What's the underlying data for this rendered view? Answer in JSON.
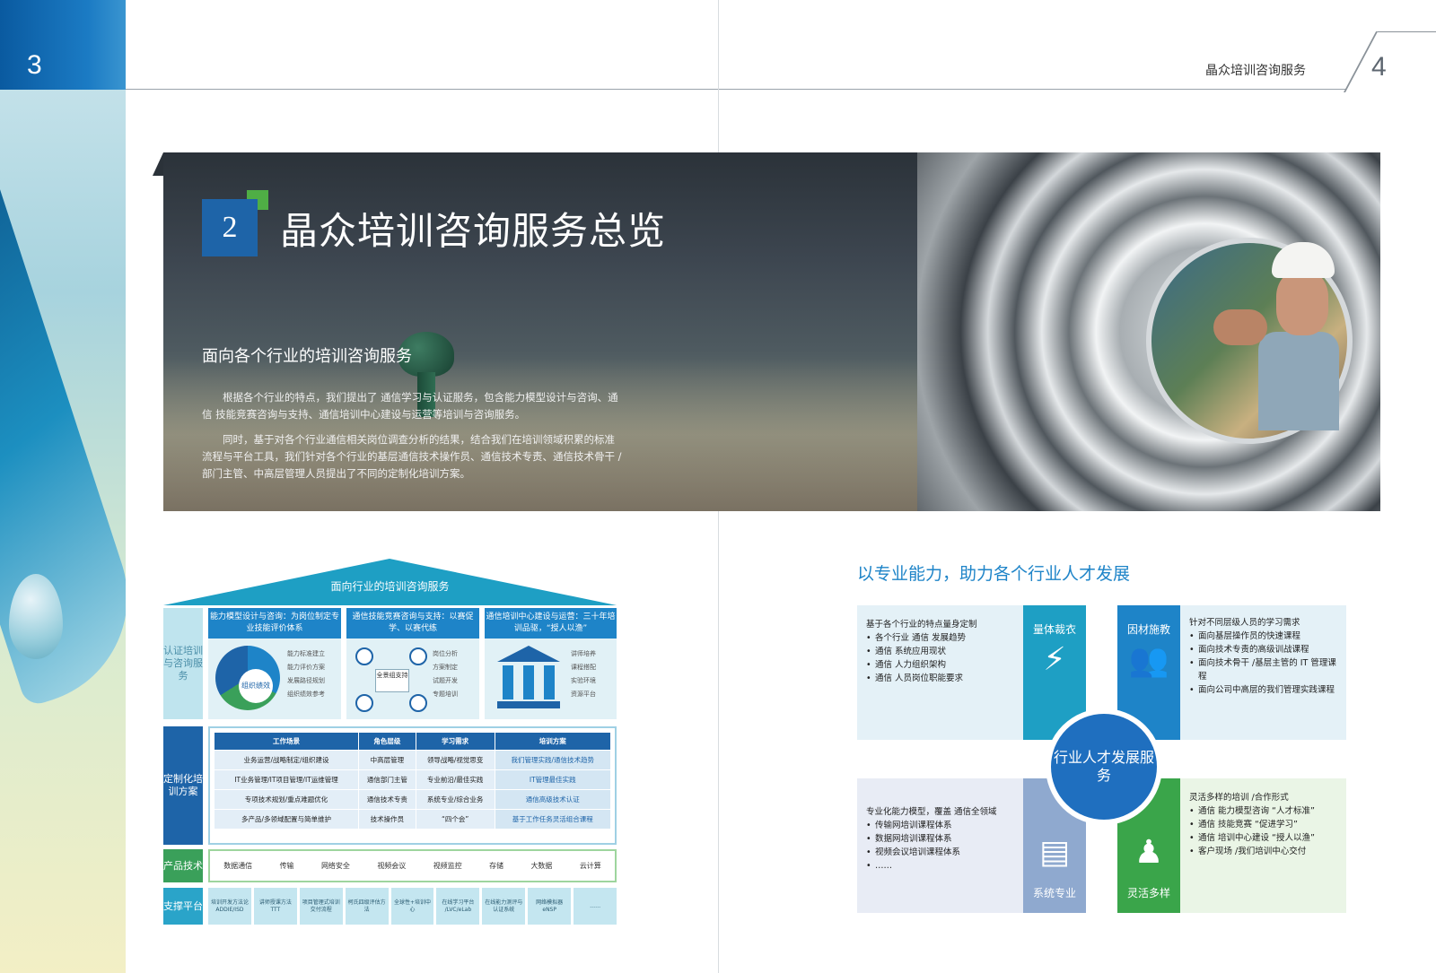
{
  "page": {
    "left_number": "3",
    "right_number": "4",
    "header_title": "晶众培训咨询服务"
  },
  "hero": {
    "section_number": "2",
    "section_title": "晶众培训咨询服务总览",
    "subtitle": "面向各个行业的培训咨询服务",
    "paragraph_1": "根据各个行业的特点，我们提出了 通信学习与认证服务，包含能力模型设计与咨询、通信 技能竞赛咨询与支持、通信培训中心建设与运营等培训与咨询服务。",
    "paragraph_2": "同时，基于对各个行业通信相关岗位调查分析的结果，结合我们在培训领域积累的标准流程与平台工具，我们针对各个行业的基层通信技术操作员、通信技术专责、通信技术骨干 /部门主管、中高层管理人员提出了不同的定制化培训方案。"
  },
  "left_diagram": {
    "roof_label": "面向行业的培训咨询服务",
    "side_labels": [
      "认证培训与咨询服务",
      "定制化培训方案",
      "产品技术",
      "支撑平台"
    ],
    "services": [
      {
        "title": "能力模型设计与咨询：为岗位制定专业技能评价体系",
        "center": "组织绩效",
        "items": [
          "能力标准建立",
          "能力评价方案",
          "发展路径规划",
          "组织绩效参考"
        ]
      },
      {
        "title": "通信技能竞赛咨询与支持：以赛促学、以赛代练",
        "center": "全景组支持",
        "items": [
          "岗位分析",
          "方案制定",
          "试题开发",
          "专题培训"
        ]
      },
      {
        "title": "通信培训中心建设与运营：三十年培训品驱，“授人以渔”",
        "center": "",
        "items": [
          "讲师培养",
          "课程搭配",
          "实验环境",
          "资源平台"
        ]
      }
    ],
    "table_headers": [
      "工作场景",
      "角色层级",
      "学习需求",
      "培训方案"
    ],
    "table_rows": [
      [
        "业务运营/战略制定/组织建设",
        "中高层管理",
        "领导战略/视觉思变",
        "我们管理实践/通信技术趋势"
      ],
      [
        "IT业务管理/IT项目管理/IT运维管理",
        "通信部门主管",
        "专业前沿/最佳实践",
        "IT管理最佳实践"
      ],
      [
        "专项技术规划/重点难题优化",
        "通信技术专责",
        "系统专业/综合业务",
        "通信高级技术认证"
      ],
      [
        "多产品/多领域配置与简单维护",
        "技术操作员",
        "“四个会”",
        "基于工作任务灵活组合课程"
      ]
    ],
    "products": [
      "数据通信",
      "传输",
      "网络安全",
      "视频会议",
      "视频监控",
      "存储",
      "大数据",
      "云计算"
    ],
    "support": [
      "培训开发方法论 ADDIE/ISD",
      "讲师授课方法TTT",
      "项目管理式培训交付流程",
      "柯氏四级评估方法",
      "全球性+培训中心",
      "在线学习平台 /LVC/eLab",
      "在线能力测评与认证系统",
      "网络模拟器 eNSP",
      "……"
    ]
  },
  "right_diagram": {
    "heading": "以专业能力，助力各个行业人才发展",
    "center": "行业人才发展服务",
    "quadrants": [
      {
        "label": "量体裁衣",
        "icon": "power-tower-icon",
        "intro": "基于各个行业的特点量身定制",
        "items": [
          "各个行业 通信 发展趋势",
          "通信 系统应用现状",
          "通信 人力组织架构",
          "通信 人员岗位职能要求"
        ]
      },
      {
        "label": "因材施教",
        "icon": "people-group-icon",
        "intro": "针对不同层级人员的学习需求",
        "items": [
          "面向基层操作员的快速课程",
          "面向技术专责的高级训战课程",
          "面向技术骨干 /基层主管的 IT 管理课程",
          "面向公司中高层的我们管理实践课程"
        ]
      },
      {
        "label": "系统专业",
        "icon": "documents-icon",
        "intro": "专业化能力模型，覆盖 通信全领域",
        "items": [
          "传输网培训课程体系",
          "数据网培训课程体系",
          "视频会议培训课程体系",
          "……"
        ]
      },
      {
        "label": "灵活多样",
        "icon": "classroom-icon",
        "intro": "灵活多样的培训 /合作形式",
        "items": [
          "通信 能力模型咨询 “人才标准”",
          "通信 技能竞赛 “促进学习”",
          "通信 培训中心建设 “授人以渔”",
          "客户现场 /我们培训中心交付"
        ]
      }
    ]
  },
  "colors": {
    "primary_blue": "#1e64a8",
    "accent_blue": "#1e84c8",
    "accent_green": "#3aa54a",
    "cyan": "#1e9fc4"
  }
}
